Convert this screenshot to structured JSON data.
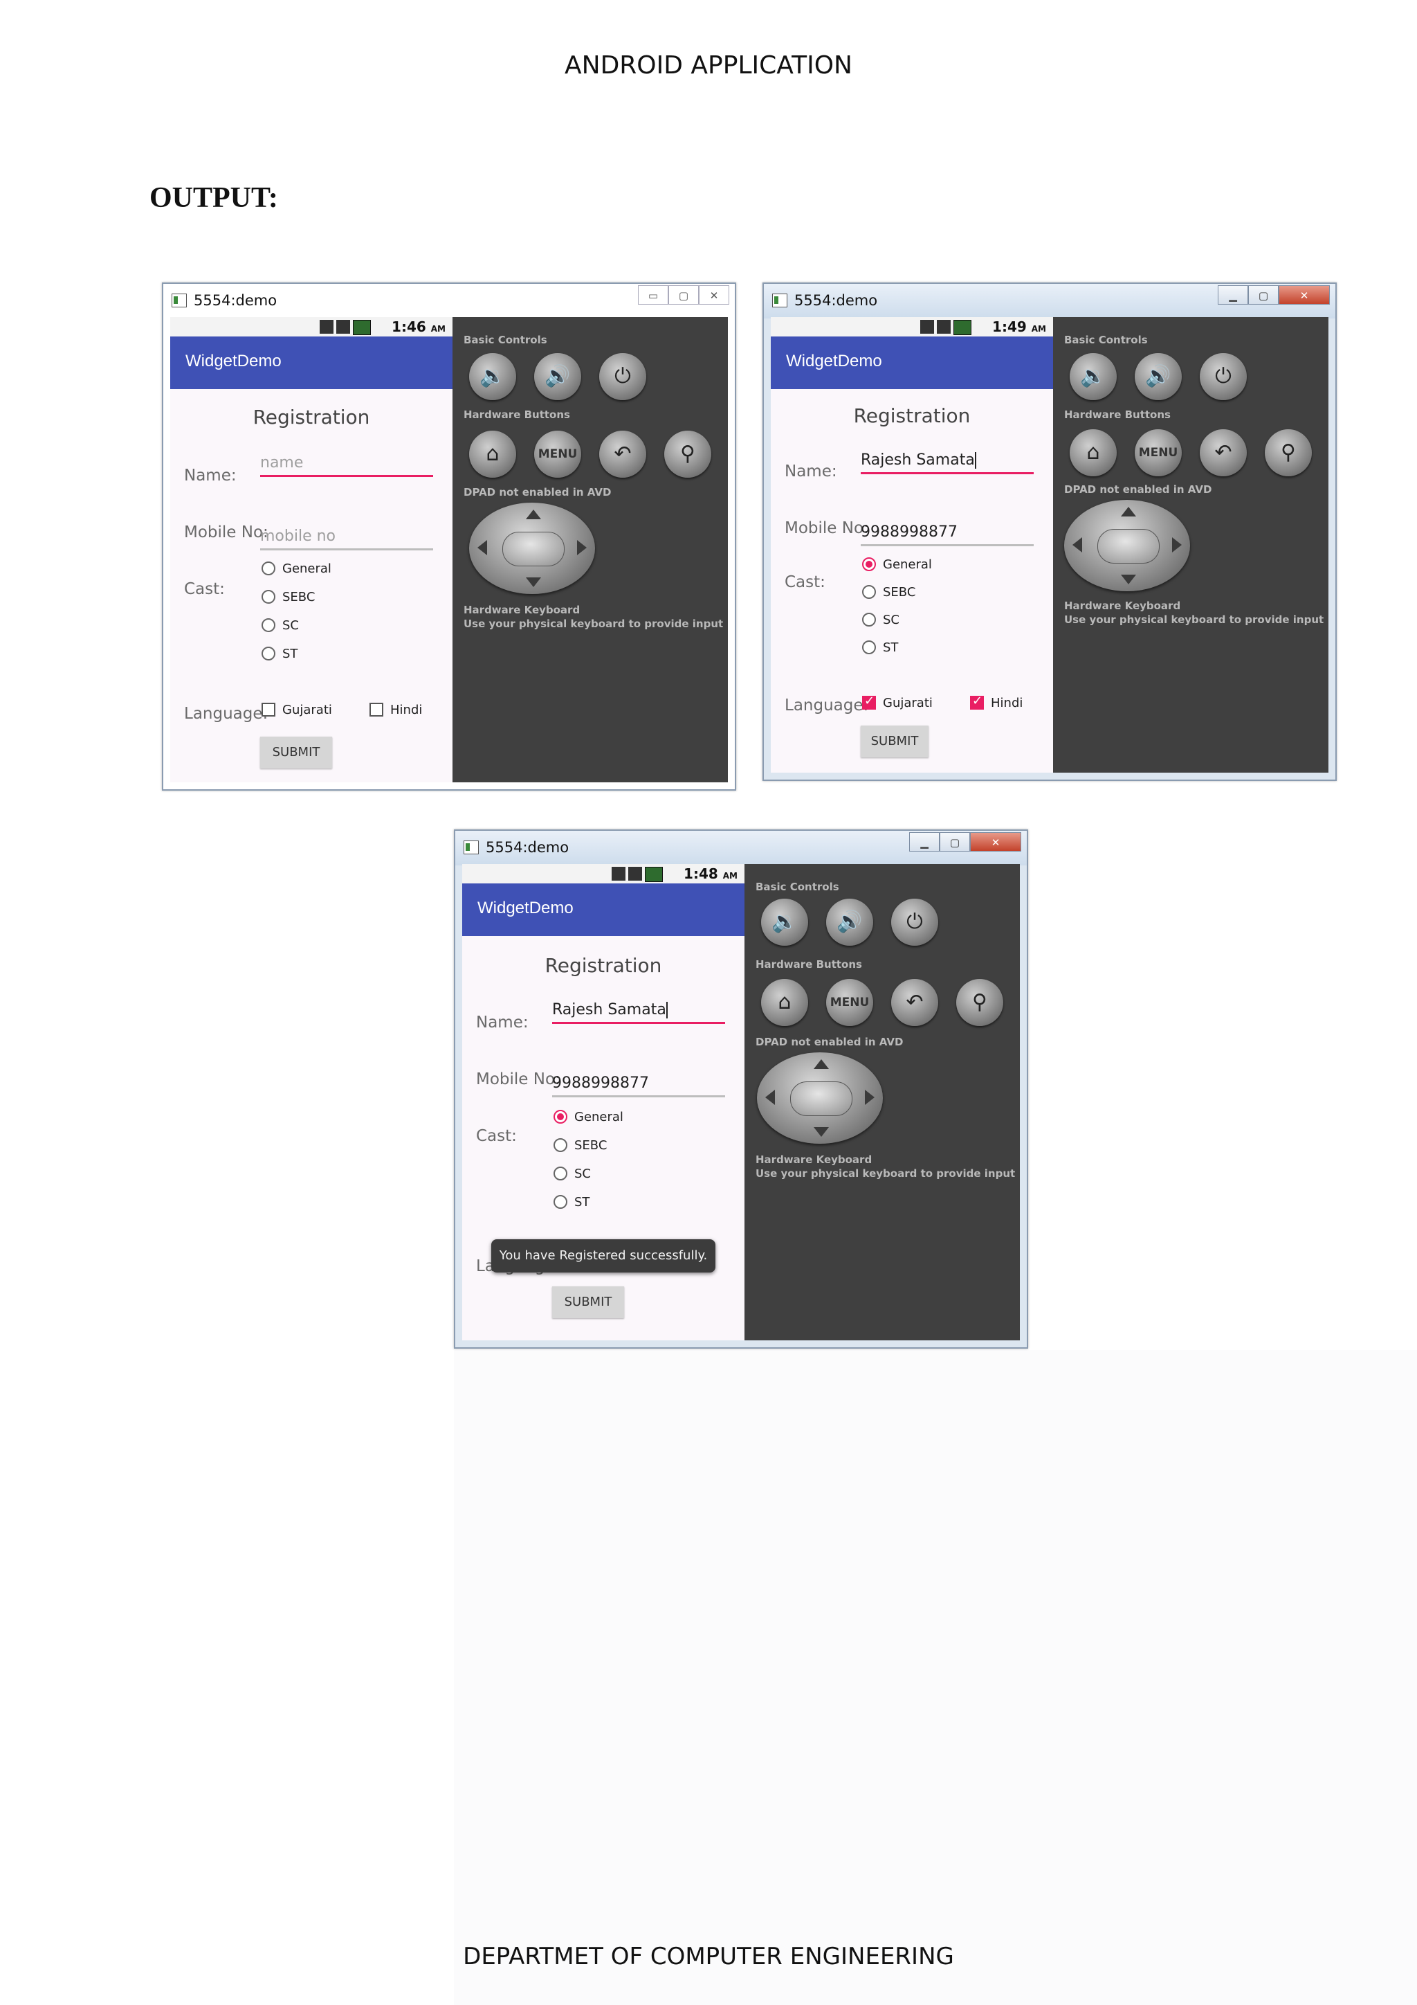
{
  "page": {
    "header": "ANDROID APPLICATION",
    "heading": "OUTPUT:",
    "footer": "DEPARTMET OF COMPUTER ENGINEERING"
  },
  "common": {
    "window_title": "5554:demo",
    "app_title": "WidgetDemo",
    "form_title": "Registration",
    "name_label": "Name:",
    "mobile_label": "Mobile No:",
    "cast_label": "Cast:",
    "language_label": "Language:",
    "cast_options": [
      "General",
      "SEBC",
      "SC",
      "ST"
    ],
    "language_options": [
      "Gujarati",
      "Hindi"
    ],
    "submit_label": "SUBMIT",
    "controls": {
      "basic_controls": "Basic Controls",
      "hardware_buttons": "Hardware Buttons",
      "dpad_text": "DPAD not enabled in AVD",
      "keyboard_title": "Hardware Keyboard",
      "keyboard_text": "Use your physical keyboard to provide input",
      "menu_label": "MENU",
      "time_suffix": "AM"
    },
    "accent_color": "#e91e63",
    "actionbar_color": "#3f51b5"
  },
  "screens": [
    {
      "time": "1:46",
      "name_placeholder": "name",
      "mobile_placeholder": "mobile no",
      "name_value": "",
      "mobile_value": "",
      "cast_selected": "",
      "languages_checked": []
    },
    {
      "time": "1:49",
      "name_value": "Rajesh Samata",
      "mobile_value": "9988998877",
      "cast_selected": "General",
      "languages_checked": [
        "Gujarati",
        "Hindi"
      ]
    },
    {
      "time": "1:48",
      "name_value": "Rajesh Samata",
      "mobile_value": "9988998877",
      "cast_selected": "General",
      "languages_checked": [
        "Gujarati",
        "Hindi"
      ],
      "toast": "You have Registered successfully."
    }
  ]
}
